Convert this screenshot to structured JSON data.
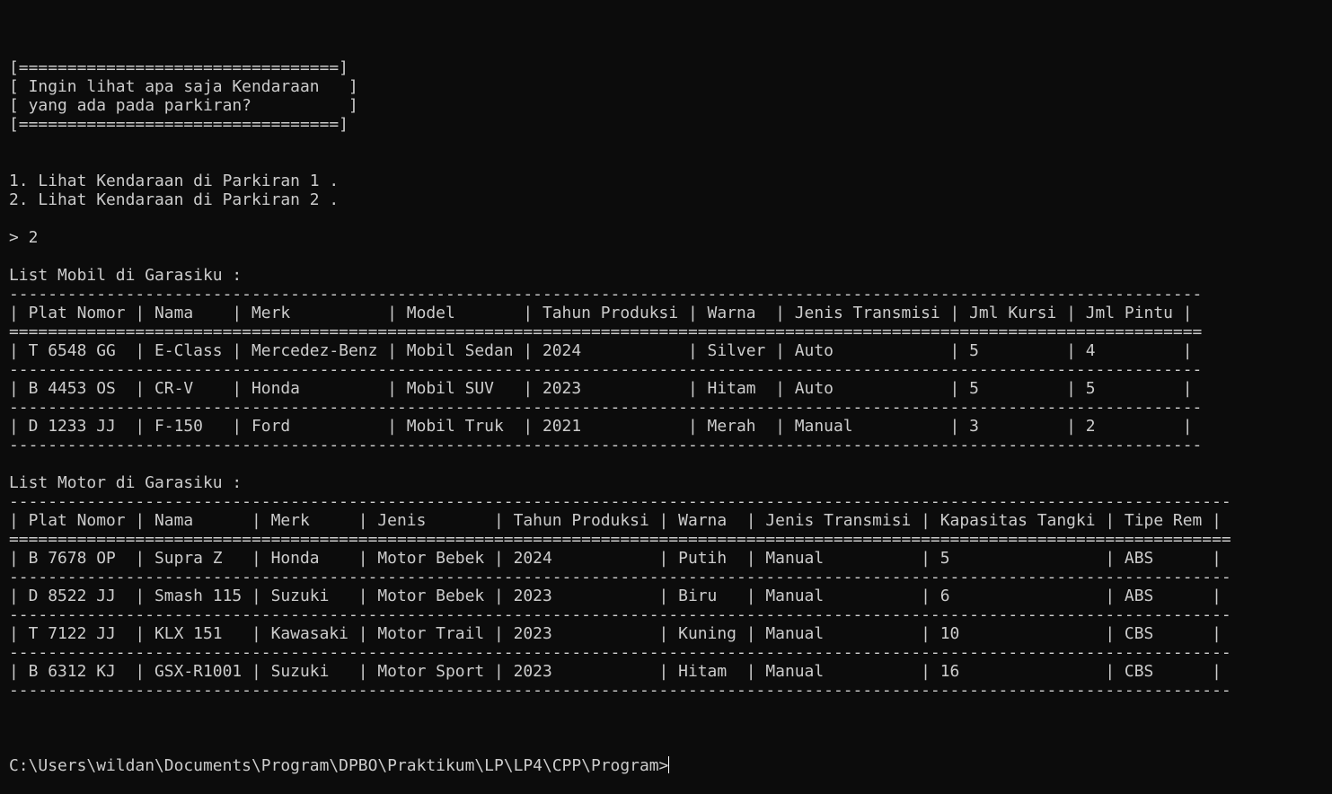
{
  "terminal": {
    "lines": [
      "[=================================]",
      "[ Ingin lihat apa saja Kendaraan   ]",
      "[ yang ada pada parkiran?          ]",
      "[=================================]",
      "",
      "",
      "1. Lihat Kendaraan di Parkiran 1 .",
      "2. Lihat Kendaraan di Parkiran 2 .",
      "",
      "> 2",
      "",
      "List Mobil di Garasiku :",
      "---------------------------------------------------------------------------------------------------------------------------",
      "| Plat Nomor | Nama    | Merk          | Model       | Tahun Produksi | Warna  | Jenis Transmisi | Jml Kursi | Jml Pintu |",
      "===========================================================================================================================",
      "| T 6548 GG  | E-Class | Mercedez-Benz | Mobil Sedan | 2024           | Silver | Auto            | 5         | 4         |",
      "---------------------------------------------------------------------------------------------------------------------------",
      "| B 4453 OS  | CR-V    | Honda         | Mobil SUV   | 2023           | Hitam  | Auto            | 5         | 5         |",
      "---------------------------------------------------------------------------------------------------------------------------",
      "| D 1233 JJ  | F-150   | Ford          | Mobil Truk  | 2021           | Merah  | Manual          | 3         | 2         |",
      "---------------------------------------------------------------------------------------------------------------------------",
      "",
      "List Motor di Garasiku :",
      "------------------------------------------------------------------------------------------------------------------------------",
      "| Plat Nomor | Nama      | Merk     | Jenis       | Tahun Produksi | Warna  | Jenis Transmisi | Kapasitas Tangki | Tipe Rem |",
      "==============================================================================================================================",
      "| B 7678 OP  | Supra Z   | Honda    | Motor Bebek | 2024           | Putih  | Manual          | 5                | ABS      |",
      "------------------------------------------------------------------------------------------------------------------------------",
      "| D 8522 JJ  | Smash 115 | Suzuki   | Motor Bebek | 2023           | Biru   | Manual          | 6                | ABS      |",
      "------------------------------------------------------------------------------------------------------------------------------",
      "| T 7122 JJ  | KLX 151   | Kawasaki | Motor Trail | 2023           | Kuning | Manual          | 10               | CBS      |",
      "------------------------------------------------------------------------------------------------------------------------------",
      "| B 6312 KJ  | GSX-R1001 | Suzuki   | Motor Sport | 2023           | Hitam  | Manual          | 16               | CBS      |",
      "------------------------------------------------------------------------------------------------------------------------------",
      ""
    ],
    "prompt": "C:\\Users\\wildan\\Documents\\Program\\DPBO\\Praktikum\\LP\\LP4\\CPP\\Program>"
  },
  "colors": {
    "background": "#0c0c0c",
    "foreground": "#cccccc",
    "cursor": "#ffffff"
  }
}
